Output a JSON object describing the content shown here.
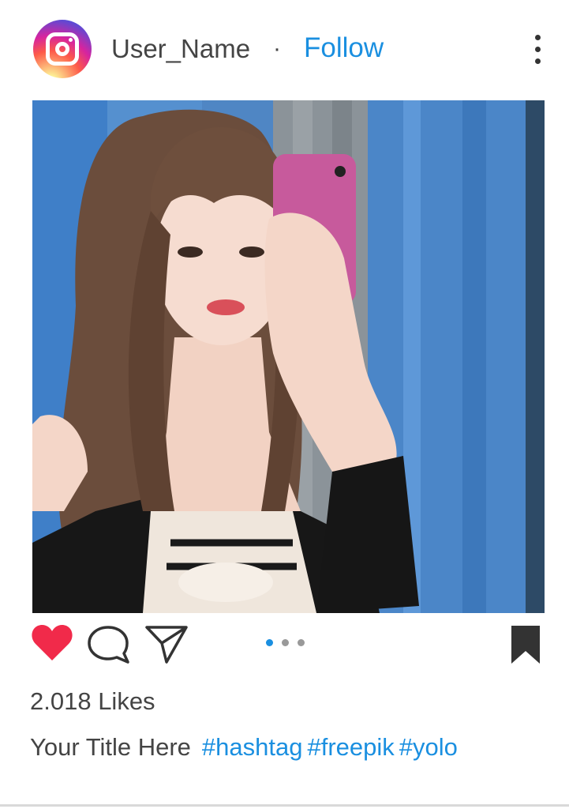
{
  "header": {
    "username": "User_Name",
    "separator": "·",
    "follow_label": "Follow",
    "avatar_icon": "instagram-logo-icon",
    "more_icon": "more-vertical-icon"
  },
  "post": {
    "image_alt": "Selfie photo of a young woman with long brown hair holding a pink phone in front of blue curtains",
    "carousel": {
      "count": 3,
      "active_index": 0
    }
  },
  "actions": {
    "like_icon": "heart-icon",
    "liked": true,
    "comment_icon": "comment-icon",
    "share_icon": "send-icon",
    "save_icon": "bookmark-icon"
  },
  "likes_text": "2.018 Likes",
  "caption": {
    "title": "Your Title Here",
    "hashtags": [
      "#hashtag",
      "#freepik",
      "#yolo"
    ]
  },
  "colors": {
    "accent": "#1a8fe0",
    "heart": "#f12a4a",
    "text": "#444444",
    "icon": "#333333"
  }
}
